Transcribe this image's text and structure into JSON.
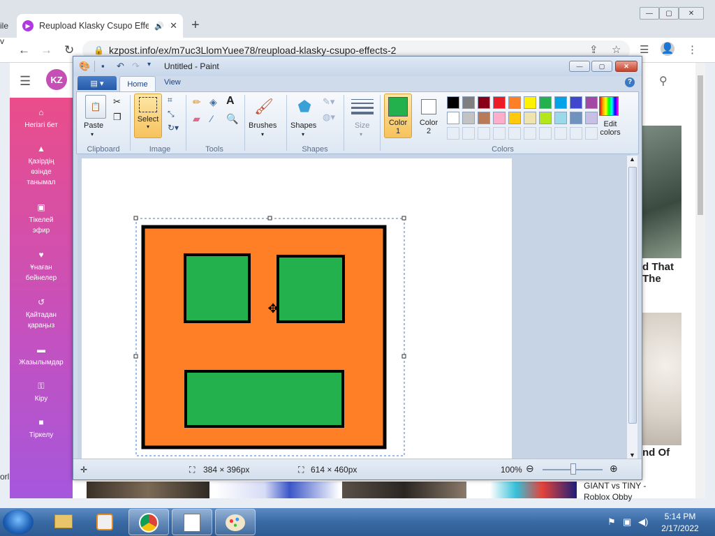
{
  "browser": {
    "tab_title": "Reupload Klasky Csupo Effec",
    "tab_favicon": "play-icon",
    "new_tab": "+",
    "url": "kzpost.info/ex/m7uc3LlomYuee78/reupload-klasky-csupo-effects-2",
    "window_controls": [
      "minimize",
      "restore",
      "close"
    ]
  },
  "site": {
    "logo": "KZ",
    "menu": [
      {
        "icon": "home-icon",
        "label": "Негізгі бет"
      },
      {
        "icon": "fire-icon",
        "label": "Қазірдің өзінде танымал"
      },
      {
        "icon": "live-icon",
        "label": "Тікелей эфир"
      },
      {
        "icon": "heart-icon",
        "label": "Ұнаған бейнелер"
      },
      {
        "icon": "history-icon",
        "label": "Қайтадан қараңыз"
      },
      {
        "icon": "folder-icon",
        "label": "Жазылымдар"
      },
      {
        "icon": "key-icon",
        "label": "Кіру"
      },
      {
        "icon": "lock-icon",
        "label": "Тіркелу"
      }
    ],
    "card_text_1": "d That The",
    "card_text_2": "nd Of",
    "card_text_3_line1": "GIANT vs TINY -",
    "card_text_3_line2": "Roblox Obby",
    "left_edge_fragments": [
      "ile",
      "v",
      "orl"
    ]
  },
  "paint": {
    "title": "Untitled - Paint",
    "tabs": {
      "home": "Home",
      "view": "View"
    },
    "groups": {
      "clipboard": "Clipboard",
      "image": "Image",
      "tools": "Tools",
      "shapes": "Shapes",
      "colors": "Colors"
    },
    "buttons": {
      "paste": "Paste",
      "select": "Select",
      "brushes": "Brushes",
      "shapes": "Shapes",
      "size": "Size",
      "color1": "Color 1",
      "color2": "Color 2",
      "edit_colors": "Edit colors"
    },
    "color1_value": "#22b14c",
    "color2_value": "#ffffff",
    "palette_row1": [
      "#000000",
      "#7f7f7f",
      "#880015",
      "#ed1c24",
      "#ff7f27",
      "#fff200",
      "#22b14c",
      "#00a2e8",
      "#3f48cc",
      "#a349a4"
    ],
    "palette_row2": [
      "#ffffff",
      "#c3c3c3",
      "#b97a57",
      "#ffaec9",
      "#ffc90e",
      "#efe4b0",
      "#b5e61d",
      "#99d9ea",
      "#7092be",
      "#c8bfe7"
    ],
    "status": {
      "selection_size": "384 × 396px",
      "canvas_size": "614 × 460px",
      "zoom": "100%"
    },
    "drawing": {
      "background": "#ff7f27",
      "eye_color": "#22b14c",
      "outline": "#000000"
    }
  },
  "taskbar": {
    "time": "5:14 PM",
    "date": "2/17/2022",
    "apps": [
      "explorer",
      "media-player",
      "chrome",
      "notepad-paint",
      "paint"
    ]
  }
}
